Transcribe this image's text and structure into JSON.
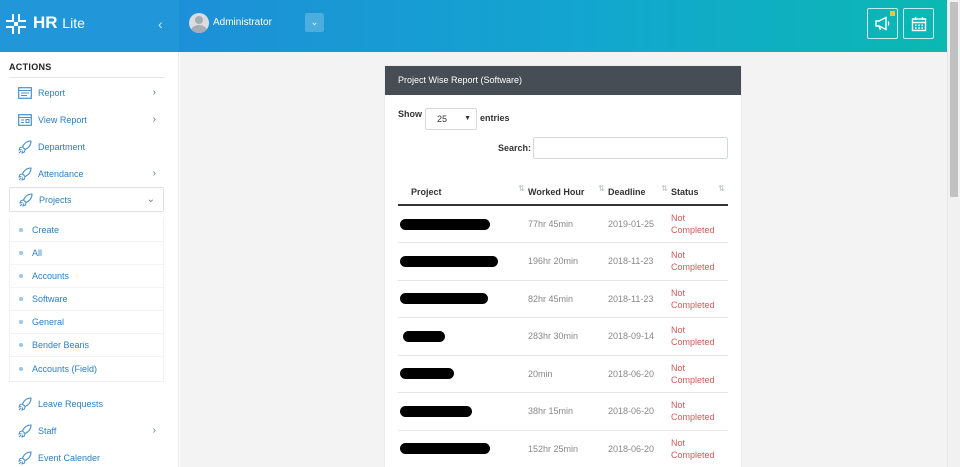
{
  "app": {
    "brand_bold": "HR",
    "brand_light": "Lite"
  },
  "header": {
    "user_name": "Administrator"
  },
  "sidebar": {
    "section_title": "ACTIONS",
    "items": [
      {
        "label": "Report",
        "icon": "report-icon",
        "has_chevron": true
      },
      {
        "label": "View Report",
        "icon": "view-report-icon",
        "has_chevron": true
      },
      {
        "label": "Department",
        "icon": "rocket-icon",
        "has_chevron": false
      },
      {
        "label": "Attendance",
        "icon": "calendar-icon",
        "has_chevron": true
      },
      {
        "label": "Projects",
        "icon": "rocket-icon",
        "has_chevron": true,
        "expanded": true
      }
    ],
    "project_subitems": [
      "Create",
      "All",
      "Accounts",
      "Software",
      "General",
      "Bender Beans",
      "Accounts (Field)"
    ],
    "items_after": [
      {
        "label": "Leave Requests",
        "icon": "rocket-icon",
        "has_chevron": false
      },
      {
        "label": "Staff",
        "icon": "rocket-icon",
        "has_chevron": true
      },
      {
        "label": "Event Calender",
        "icon": "rocket-icon",
        "has_chevron": false
      }
    ]
  },
  "panel": {
    "title": "Project Wise Report (Software)",
    "show_label": "Show",
    "entries_value": "25",
    "entries_label": "entries",
    "search_label": "Search:",
    "columns": [
      "Project",
      "Worked Hour",
      "Deadline",
      "Status"
    ],
    "rows": [
      {
        "worked": "77hr 45min",
        "deadline": "2019-01-25",
        "status": "Not Completed"
      },
      {
        "worked": "196hr 20min",
        "deadline": "2018-11-23",
        "status": "Not Completed"
      },
      {
        "worked": "82hr 45min",
        "deadline": "2018-11-23",
        "status": "Not Completed"
      },
      {
        "worked": "283hr 30min",
        "deadline": "2018-09-14",
        "status": "Not Completed"
      },
      {
        "worked": "20min",
        "deadline": "2018-06-20",
        "status": "Not Completed"
      },
      {
        "worked": "38hr 15min",
        "deadline": "2018-06-20",
        "status": "Not Completed"
      },
      {
        "worked": "152hr 25min",
        "deadline": "2018-06-20",
        "status": "Not Completed"
      }
    ]
  },
  "colors": {
    "brand": "#2196d9",
    "topbar_end": "#0bb8b2",
    "panel_header": "#464d55",
    "link": "#2b7fc3",
    "status_red": "#d05a5a"
  }
}
